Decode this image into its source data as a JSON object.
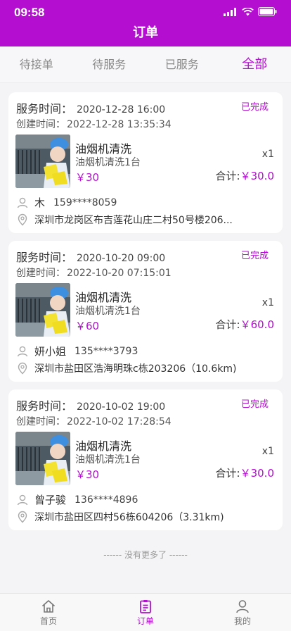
{
  "status_bar": {
    "time": "09:58"
  },
  "header": {
    "title": "订单"
  },
  "tabs": [
    {
      "label": "待接单"
    },
    {
      "label": "待服务"
    },
    {
      "label": "已服务"
    },
    {
      "label": "全部"
    }
  ],
  "active_tab": "全部",
  "orders": [
    {
      "service_label": "服务时间：",
      "service_time": "2020-12-28  16:00",
      "create_label": "创建时间：",
      "create_time": "2022-12-28 13:35:34",
      "status": "已完成",
      "product_name": "油烟机清洗",
      "product_desc": "油烟机清洗1台",
      "price": "￥30",
      "qty": "x1",
      "total_label": "合计:",
      "total": "￥30.0",
      "customer": "木",
      "phone": "159****8059",
      "address": "深圳市龙岗区布吉莲花山庄二村50号楼206..."
    },
    {
      "service_label": "服务时间：",
      "service_time": "2020-10-20  09:00",
      "create_label": "创建时间：",
      "create_time": "2022-10-20 07:15:01",
      "status": "已完成",
      "product_name": "油烟机清洗",
      "product_desc": "油烟机清洗1台",
      "price": "￥60",
      "qty": "x1",
      "total_label": "合计:",
      "total": "￥60.0",
      "customer": "妍小姐",
      "phone": "135****3793",
      "address": "深圳市盐田区浩海明珠c栋203206（10.6km)"
    },
    {
      "service_label": "服务时间：",
      "service_time": "2020-10-02  19:00",
      "create_label": "创建时间：",
      "create_time": "2022-10-02 17:28:54",
      "status": "已完成",
      "product_name": "油烟机清洗",
      "product_desc": "油烟机清洗1台",
      "price": "￥30",
      "qty": "x1",
      "total_label": "合计:",
      "total": "￥30.0",
      "customer": "曾子骏",
      "phone": "136****4896",
      "address": "深圳市盐田区四村56栋604206（3.31km)"
    }
  ],
  "no_more": "------  没有更多了  ------",
  "bottom_nav": [
    {
      "label": "首页",
      "icon": "home-icon"
    },
    {
      "label": "订单",
      "icon": "order-icon"
    },
    {
      "label": "我的",
      "icon": "profile-icon"
    }
  ],
  "colors": {
    "accent": "#b40fd0",
    "background": "#f4f4f6"
  }
}
